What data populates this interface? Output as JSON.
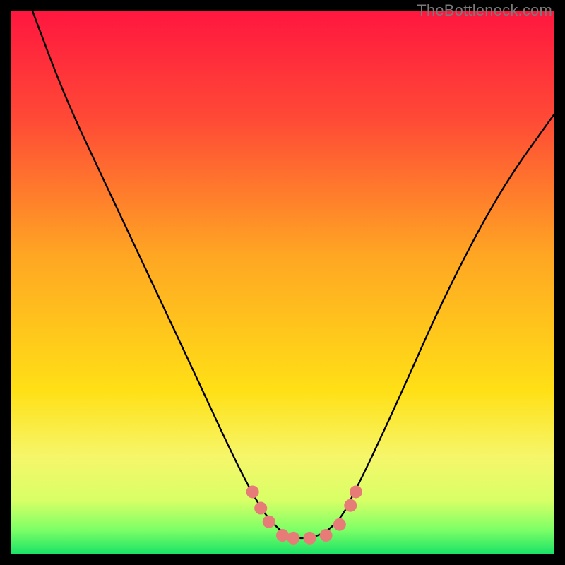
{
  "watermark": "TheBottleneck.com",
  "chart_data": {
    "type": "line",
    "title": "",
    "xlabel": "",
    "ylabel": "",
    "xlim": [
      0,
      100
    ],
    "ylim": [
      0,
      100
    ],
    "background_gradient": {
      "stops": [
        {
          "pos": 0.0,
          "color": "#ff163f"
        },
        {
          "pos": 0.2,
          "color": "#ff4a36"
        },
        {
          "pos": 0.45,
          "color": "#ffa623"
        },
        {
          "pos": 0.7,
          "color": "#ffe016"
        },
        {
          "pos": 0.82,
          "color": "#f6f66a"
        },
        {
          "pos": 0.9,
          "color": "#d9ff66"
        },
        {
          "pos": 0.955,
          "color": "#7dff66"
        },
        {
          "pos": 1.0,
          "color": "#18e267"
        }
      ]
    },
    "series": [
      {
        "name": "bottleneck-curve",
        "stroke": "#000000",
        "x": [
          4,
          10,
          18,
          26,
          34,
          40,
          44,
          47,
          50,
          52,
          55,
          58,
          61,
          63,
          66,
          72,
          80,
          90,
          100
        ],
        "y": [
          100,
          84,
          67,
          50,
          33,
          20,
          12,
          7,
          4,
          3,
          3,
          4,
          7,
          11,
          17,
          30,
          48,
          67,
          81
        ]
      }
    ],
    "markers": {
      "name": "highlight-points",
      "color": "#e77b78",
      "points": [
        {
          "x": 44.5,
          "y": 11.5
        },
        {
          "x": 46.0,
          "y": 8.5
        },
        {
          "x": 47.5,
          "y": 6.0
        },
        {
          "x": 50.0,
          "y": 3.5
        },
        {
          "x": 52.0,
          "y": 3.0
        },
        {
          "x": 55.0,
          "y": 3.0
        },
        {
          "x": 58.0,
          "y": 3.5
        },
        {
          "x": 60.5,
          "y": 5.5
        },
        {
          "x": 62.5,
          "y": 9.0
        },
        {
          "x": 63.5,
          "y": 11.5
        }
      ]
    }
  }
}
